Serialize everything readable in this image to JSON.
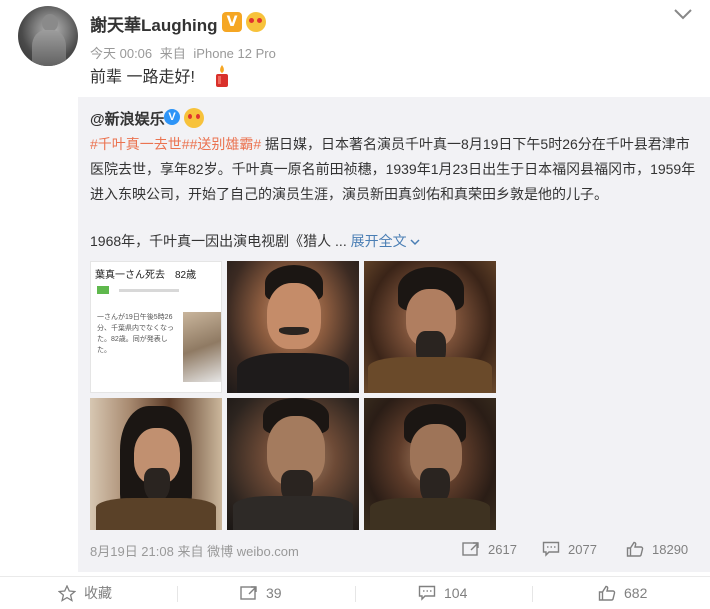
{
  "post": {
    "author": "謝天華Laughing",
    "verified_badge": "V",
    "time": "今天 00:06",
    "source_prefix": "来自",
    "source": "iPhone 12 Pro",
    "text": "前辈 一路走好!"
  },
  "repost": {
    "author": "@新浪娱乐",
    "verified_badge": "V",
    "topic1": "#千叶真一去世#",
    "topic2": "#送别雄霸#",
    "body": " 据日媒，日本著名演员千叶真一8月19日下午5时26分在千叶县君津市医院去世，享年82岁。千叶真一原名前田祯穗，1939年1月23日出生于日本福冈县福冈市，1959年进入东映公司，开始了自己的演员生涯，演员新田真剑佑和真荣田乡敦是他的儿子。",
    "more_text": "1968年，千叶真一因出演电视剧《猎人 ...",
    "expand_label": "展开全文",
    "images": {
      "news_headline": "葉真一さん死去　82歳",
      "news_snippet": "一さんが19日午後5時26分、千葉県内でなくなった。82歳。同が発表した。"
    },
    "footer": {
      "date": "8月19日 21:08",
      "source_prefix": "来自",
      "source": "微博 weibo.com"
    },
    "stats": {
      "reposts": "2617",
      "comments": "2077",
      "likes": "18290"
    }
  },
  "actions": {
    "favorite": "收藏",
    "repost": "39",
    "comment": "104",
    "like": "682"
  },
  "colors": {
    "topic": "#eb7350",
    "link": "#4a7eb4",
    "repost_bg": "#f2f2f5",
    "vip_badge": "#f5a623",
    "blue_v": "#2d94f7"
  }
}
